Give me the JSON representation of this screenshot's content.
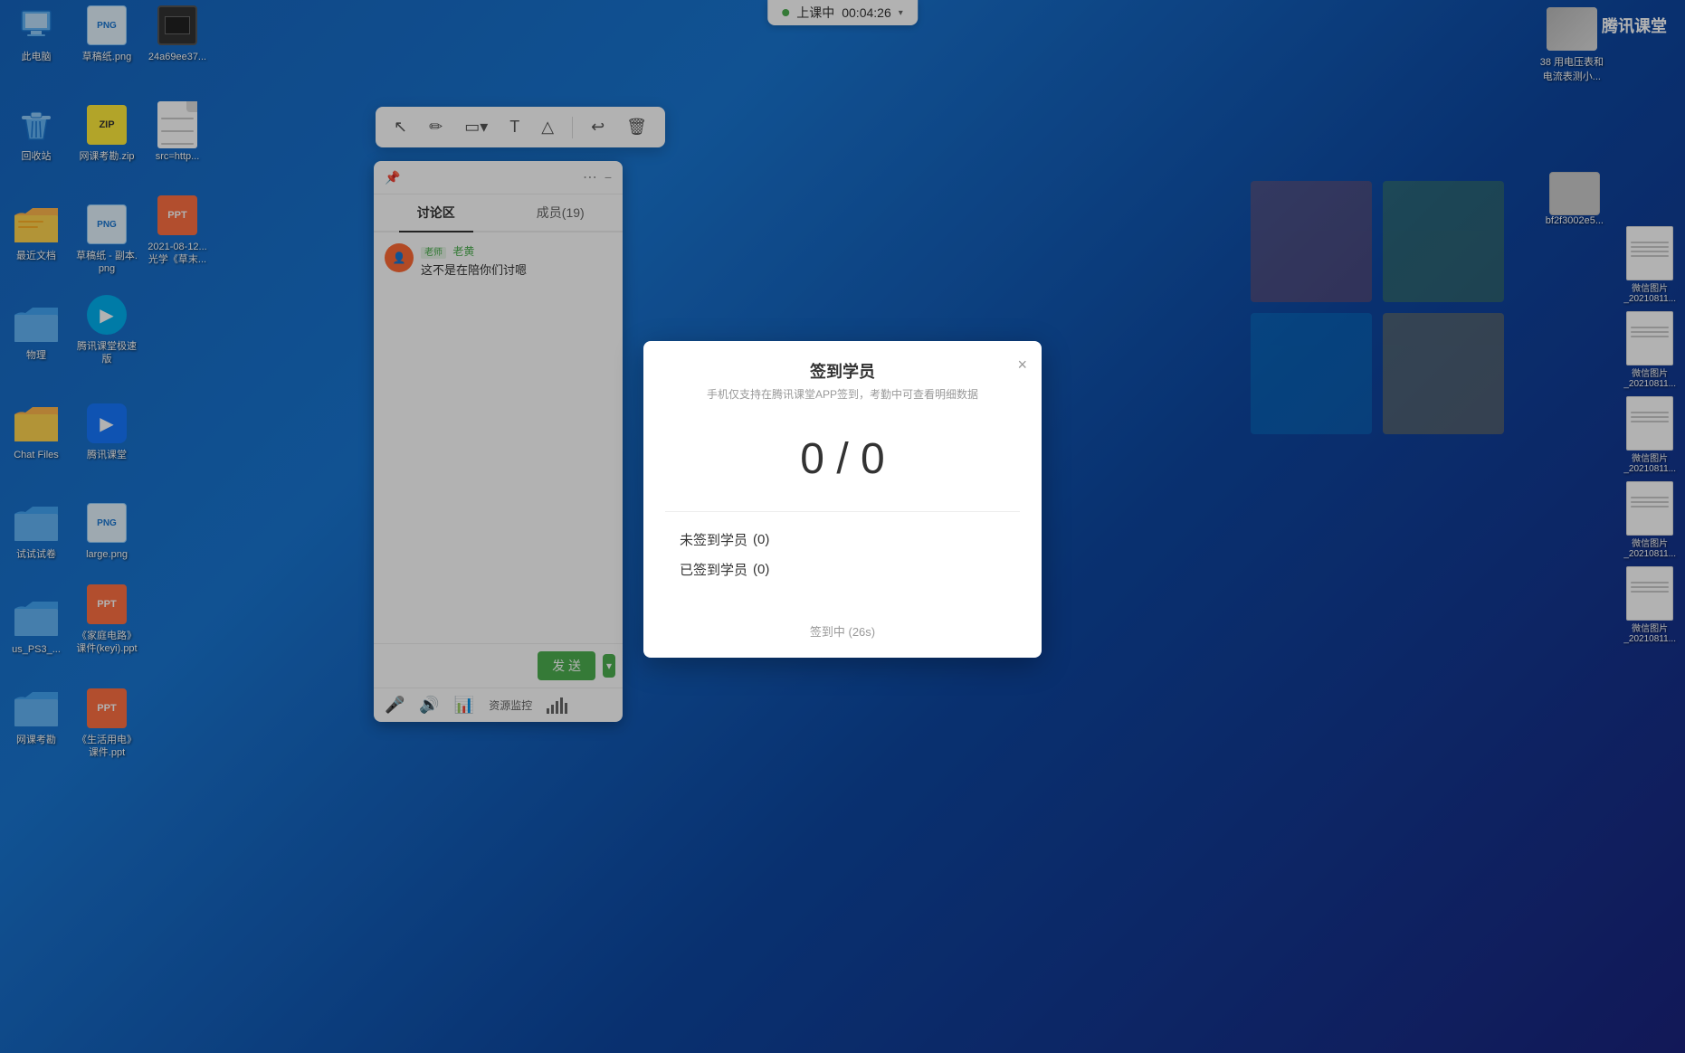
{
  "desktop": {
    "background": "blue-gradient",
    "icons_left": [
      {
        "id": "recycle-bin",
        "label": "此电脑",
        "type": "system",
        "row": 1,
        "col": 1
      },
      {
        "id": "caogaozhi-png",
        "label": "草稿纸.png",
        "type": "image",
        "row": 1,
        "col": 2
      },
      {
        "id": "img-file",
        "label": "24a69ee37...",
        "type": "image",
        "row": 1,
        "col": 3
      },
      {
        "id": "huishou",
        "label": "回收站",
        "type": "recycle",
        "row": 2,
        "col": 1
      },
      {
        "id": "wangke-zip",
        "label": "网课考勘.zip",
        "type": "zip",
        "row": 2,
        "col": 2
      },
      {
        "id": "src-file",
        "label": "src=http...",
        "type": "file",
        "row": 2,
        "col": 3
      },
      {
        "id": "zuijin-wenjian",
        "label": "最近文档",
        "type": "folder",
        "row": 3,
        "col": 1
      },
      {
        "id": "caogaozhi-copy",
        "label": "草稿纸 - 副本.png",
        "type": "image",
        "row": 3,
        "col": 2
      },
      {
        "id": "guangxue",
        "label": "2021-08-12...光学《草末...",
        "type": "ppt",
        "row": 3,
        "col": 3
      },
      {
        "id": "wuli",
        "label": "物理",
        "type": "folder",
        "row": 4,
        "col": 1
      },
      {
        "id": "tencent-speed",
        "label": "腾讯课堂极速版",
        "type": "app",
        "row": 4,
        "col": 2
      },
      {
        "id": "chat-files",
        "label": "Chat Files",
        "type": "folder",
        "row": 5,
        "col": 1
      },
      {
        "id": "tencent-app",
        "label": "腾讯课堂",
        "type": "app",
        "row": 5,
        "col": 2
      },
      {
        "id": "shijuan",
        "label": "试试试卷",
        "type": "folder",
        "row": 6,
        "col": 1
      },
      {
        "id": "large-png",
        "label": "large.png",
        "type": "image",
        "row": 6,
        "col": 2
      },
      {
        "id": "us-ps3",
        "label": "us_PS3_...",
        "type": "folder",
        "row": 7,
        "col": 1
      },
      {
        "id": "jiatingdianlu",
        "label": "《家庭电路》课件(keyi).ppt",
        "type": "ppt",
        "row": 7,
        "col": 2
      },
      {
        "id": "wangke-kaogen",
        "label": "网课考勘",
        "type": "folder",
        "row": 8,
        "col": 1
      },
      {
        "id": "shenghuo-dian",
        "label": "《生活用电》课件.ppt",
        "type": "ppt",
        "row": 8,
        "col": 2
      }
    ]
  },
  "timer_bar": {
    "status": "上课中",
    "time": "00:04:26",
    "dot_color": "#4caf50"
  },
  "tencent_logo": {
    "text": "腾讯课堂",
    "icon": "▶"
  },
  "drawing_toolbar": {
    "tools": [
      "cursor",
      "pencil",
      "rect",
      "text",
      "polygon",
      "undo",
      "delete"
    ]
  },
  "discussion_panel": {
    "tabs": [
      {
        "label": "讨论区",
        "active": true
      },
      {
        "label": "成员(19)",
        "active": false
      }
    ],
    "message": {
      "sender_role": "老师",
      "sender_name": "老黄",
      "text": "这不是在陪你们讨嗯"
    },
    "send_button": "发 送",
    "resource_label": "资源监控"
  },
  "modal": {
    "title": "签到学员",
    "subtitle": "手机仅支持在腾讯课堂APP签到，考勤中可查看明细数据",
    "score": "0 / 0",
    "stats": [
      {
        "label": "未签到学员",
        "count": "(0)"
      },
      {
        "label": "已签到学员",
        "count": "(0)"
      }
    ],
    "status": "签到中 (26s)",
    "close_button": "×"
  },
  "right_side_files": [
    {
      "label": "微信图片_20210811...",
      "type": "doc"
    },
    {
      "label": "微信图片_20210811...",
      "type": "doc"
    },
    {
      "label": "微信图片_20210811...",
      "type": "doc"
    },
    {
      "label": "微信图片_20210811...",
      "type": "doc"
    },
    {
      "label": "微信图片_20210811...",
      "type": "doc"
    }
  ],
  "top_right_icons": [
    {
      "label": "38 用电压表和电流表测小...",
      "type": "image"
    },
    {
      "label": "bf2f3002e5...",
      "type": "image"
    }
  ]
}
